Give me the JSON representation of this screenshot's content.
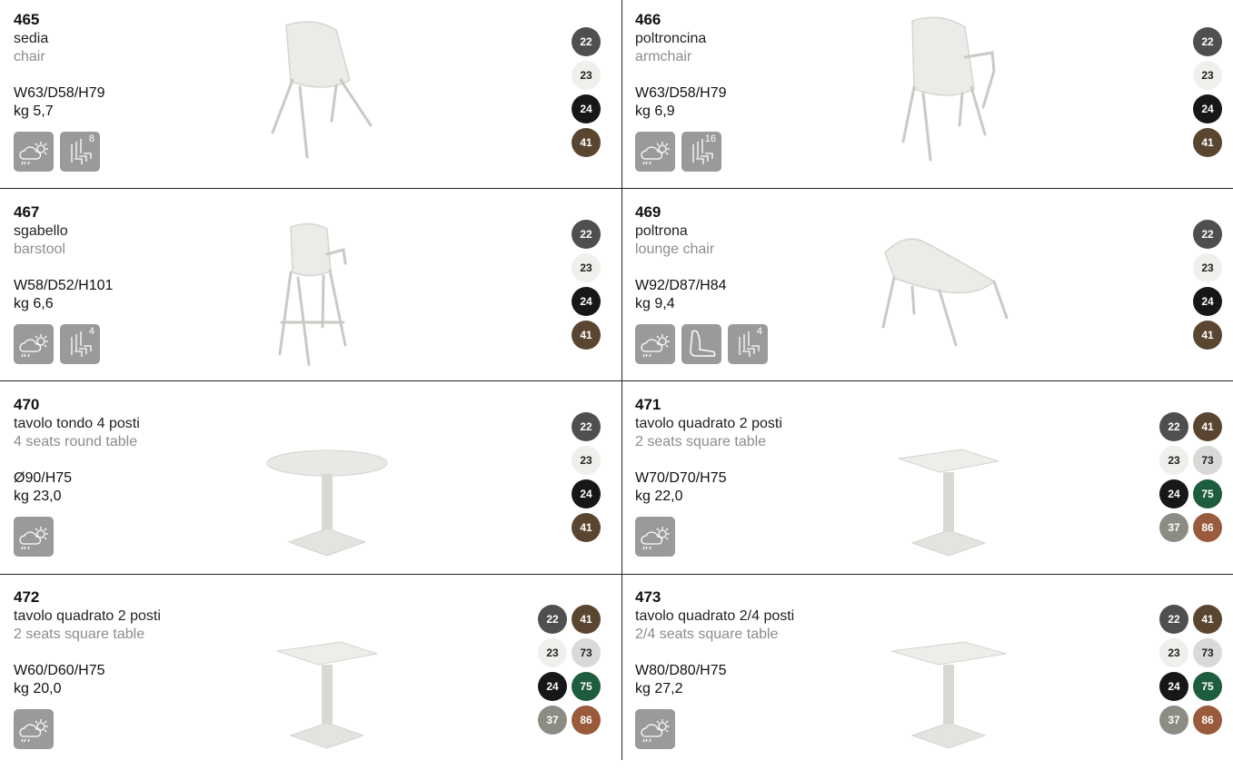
{
  "colors": {
    "22": {
      "bg": "#4f4f51",
      "fg": "#ffffff"
    },
    "23": {
      "bg": "#f1efec",
      "fg": "#222222"
    },
    "24": {
      "bg": "#171719",
      "fg": "#ffffff"
    },
    "41": {
      "bg": "#5a4630",
      "fg": "#ffffff"
    },
    "73": {
      "bg": "#d9d9d7",
      "fg": "#222222"
    },
    "75": {
      "bg": "#1e5c3e",
      "fg": "#ffffff"
    },
    "37": {
      "bg": "#8d8c84",
      "fg": "#ffffff"
    },
    "86": {
      "bg": "#9a5a3c",
      "fg": "#ffffff"
    }
  },
  "products": [
    {
      "code": "465",
      "name_it": "sedia",
      "name_en": "chair",
      "dims": "W63/D58/H79",
      "weight": "kg 5,7",
      "icons": [
        {
          "type": "weather-icon"
        },
        {
          "type": "stack-icon",
          "num": "8"
        }
      ],
      "product_image": "chair",
      "swatches": [
        [
          "22"
        ],
        [
          "23"
        ],
        [
          "24"
        ],
        [
          "41"
        ]
      ]
    },
    {
      "code": "466",
      "name_it": "poltroncina",
      "name_en": "armchair",
      "dims": "W63/D58/H79",
      "weight": "kg 6,9",
      "icons": [
        {
          "type": "weather-icon"
        },
        {
          "type": "stack-icon",
          "num": "16"
        }
      ],
      "product_image": "armchair",
      "swatches": [
        [
          "22"
        ],
        [
          "23"
        ],
        [
          "24"
        ],
        [
          "41"
        ]
      ]
    },
    {
      "code": "467",
      "name_it": "sgabello",
      "name_en": "barstool",
      "dims": "W58/D52/H101",
      "weight": "kg 6,6",
      "icons": [
        {
          "type": "weather-icon"
        },
        {
          "type": "stack-icon",
          "num": "4"
        }
      ],
      "product_image": "barstool",
      "swatches": [
        [
          "22"
        ],
        [
          "23"
        ],
        [
          "24"
        ],
        [
          "41"
        ]
      ]
    },
    {
      "code": "469",
      "name_it": "poltrona",
      "name_en": "lounge chair",
      "dims": "W92/D87/H84",
      "weight": "kg 9,4",
      "icons": [
        {
          "type": "weather-icon"
        },
        {
          "type": "cushion-icon"
        },
        {
          "type": "stack-icon",
          "num": "4"
        }
      ],
      "product_image": "lounge-chair",
      "swatches": [
        [
          "22"
        ],
        [
          "23"
        ],
        [
          "24"
        ],
        [
          "41"
        ]
      ]
    },
    {
      "code": "470",
      "name_it": "tavolo tondo 4 posti",
      "name_en": "4 seats round table",
      "dims": "Ø90/H75",
      "weight": "kg 23,0",
      "icons": [
        {
          "type": "weather-icon"
        }
      ],
      "product_image": "round-table",
      "swatches": [
        [
          "22"
        ],
        [
          "23"
        ],
        [
          "24"
        ],
        [
          "41"
        ]
      ]
    },
    {
      "code": "471",
      "name_it": "tavolo quadrato 2 posti",
      "name_en": "2 seats square table",
      "dims": "W70/D70/H75",
      "weight": "kg 22,0",
      "icons": [
        {
          "type": "weather-icon"
        }
      ],
      "product_image": "square-table",
      "swatches": [
        [
          "22",
          "41"
        ],
        [
          "23",
          "73"
        ],
        [
          "24",
          "75"
        ],
        [
          "37",
          "86"
        ]
      ]
    },
    {
      "code": "472",
      "name_it": "tavolo quadrato 2 posti",
      "name_en": "2 seats square table",
      "dims": "W60/D60/H75",
      "weight": "kg 20,0",
      "icons": [
        {
          "type": "weather-icon"
        }
      ],
      "product_image": "square-table",
      "swatches": [
        [
          "22",
          "41"
        ],
        [
          "23",
          "73"
        ],
        [
          "24",
          "75"
        ],
        [
          "37",
          "86"
        ]
      ]
    },
    {
      "code": "473",
      "name_it": "tavolo quadrato 2/4 posti",
      "name_en": "2/4 seats square table",
      "dims": "W80/D80/H75",
      "weight": "kg 27,2",
      "icons": [
        {
          "type": "weather-icon"
        }
      ],
      "product_image": "square-table-wide",
      "swatches": [
        [
          "22",
          "41"
        ],
        [
          "23",
          "73"
        ],
        [
          "24",
          "75"
        ],
        [
          "37",
          "86"
        ]
      ]
    }
  ]
}
